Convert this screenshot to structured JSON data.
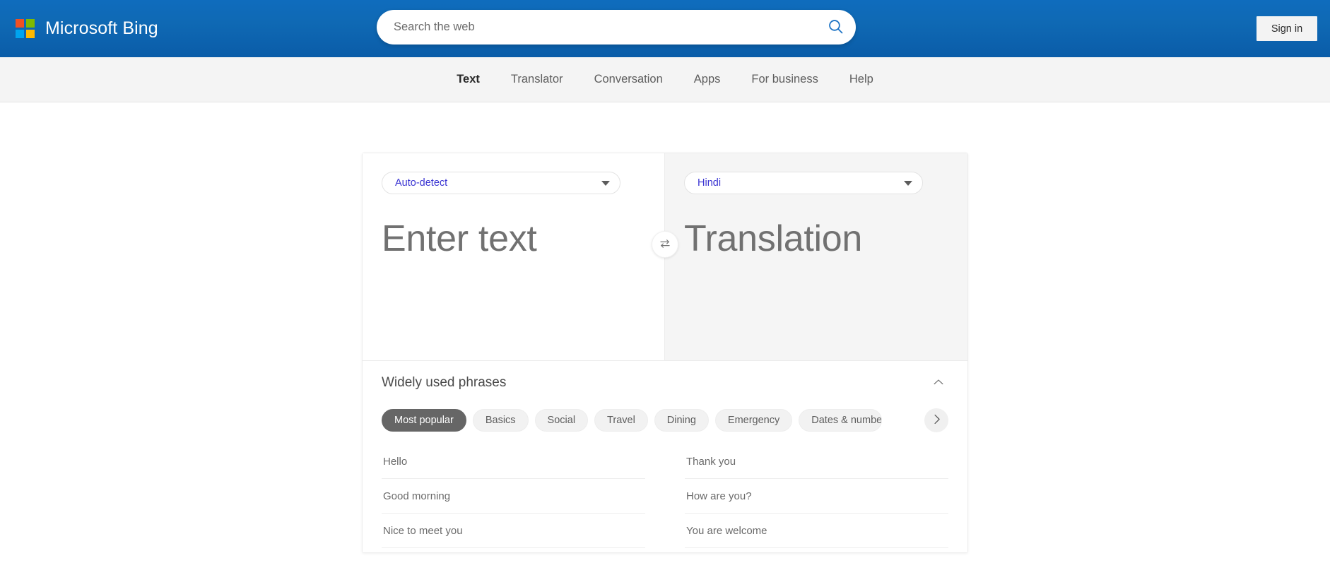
{
  "header": {
    "brand_name": "Microsoft Bing",
    "logo_icon": "microsoft-logo-icon",
    "search": {
      "placeholder": "Search the web",
      "value": "",
      "icon": "search-icon"
    },
    "signin_label": "Sign in"
  },
  "nav": {
    "items": [
      {
        "label": "Text",
        "active": true
      },
      {
        "label": "Translator",
        "active": false
      },
      {
        "label": "Conversation",
        "active": false
      },
      {
        "label": "Apps",
        "active": false
      },
      {
        "label": "For business",
        "active": false
      },
      {
        "label": "Help",
        "active": false
      }
    ]
  },
  "translator": {
    "source": {
      "language": "Auto-detect",
      "placeholder": "Enter text",
      "value": "",
      "caret_icon": "chevron-down-icon"
    },
    "target": {
      "language": "Hindi",
      "placeholder": "Translation",
      "value": "",
      "caret_icon": "chevron-down-icon"
    },
    "swap_icon": "swap-arrows-icon"
  },
  "phrases": {
    "title": "Widely used phrases",
    "collapse_icon": "chevron-up-icon",
    "next_icon": "chevron-right-icon",
    "categories": [
      {
        "label": "Most popular",
        "active": true
      },
      {
        "label": "Basics",
        "active": false
      },
      {
        "label": "Social",
        "active": false
      },
      {
        "label": "Travel",
        "active": false
      },
      {
        "label": "Dining",
        "active": false
      },
      {
        "label": "Emergency",
        "active": false
      },
      {
        "label": "Dates & numbers",
        "active": false
      }
    ],
    "left_column": [
      "Hello",
      "Good morning",
      "Nice to meet you"
    ],
    "right_column": [
      "Thank you",
      "How are you?",
      "You are welcome"
    ]
  },
  "colors": {
    "header_blue": "#0f6cbd",
    "accent_link": "#3a34d2",
    "chip_active_bg": "#666666",
    "nav_bg": "#f4f4f4"
  }
}
